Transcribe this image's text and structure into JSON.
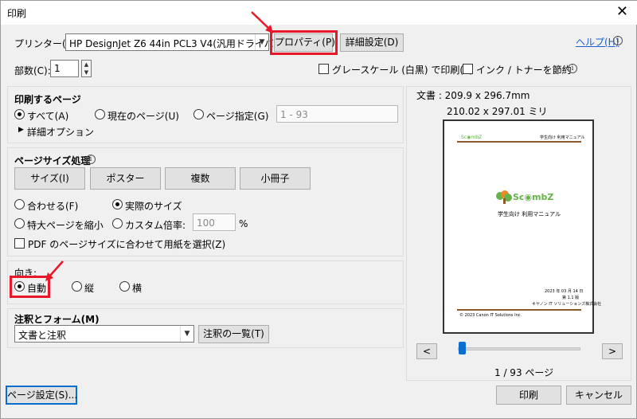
{
  "window": {
    "title": "印刷",
    "close_glyph": "✕"
  },
  "top": {
    "printer_label": "プリンター(N):",
    "printer_value": "HP DesignJet Z6 44in PCL3 V4(汎用ドライバ)",
    "properties_button": "プロパティ(P)",
    "advanced_button": "詳細設定(D)",
    "help_link": "ヘルプ(H)",
    "copies_label": "部数(C):",
    "copies_value": "1",
    "grayscale_label": "グレースケール (白黒) で印刷(Y)",
    "ink_save_label": "インク / トナーを節約"
  },
  "pages_to_print": {
    "title": "印刷するページ",
    "all": "すべて(A)",
    "current": "現在のページ(U)",
    "range": "ページ指定(G)",
    "range_value": "1 - 93",
    "more_options": "詳細オプション"
  },
  "page_sizing": {
    "title": "ページサイズ処理",
    "buttons": [
      "サイズ(I)",
      "ポスター",
      "複数",
      "小冊子"
    ],
    "fit": "合わせる(F)",
    "actual_size": "実際のサイズ",
    "shrink_oversized": "特大ページを縮小",
    "custom_scale": "カスタム倍率:",
    "custom_scale_value": "100",
    "percent": "%",
    "choose_paper_by_pdf": "PDF のページサイズに合わせて用紙を選択(Z)"
  },
  "orientation": {
    "title": "向き:",
    "auto": "自動",
    "portrait": "縦",
    "landscape": "横"
  },
  "comments": {
    "title": "注釈とフォーム(M)",
    "value": "文書と注釈",
    "summarize_button": "注釈の一覧(T)"
  },
  "preview": {
    "doc_size": "文書 : 209.9 x 296.7mm",
    "paper_size": "210.02 x 297.01 ミリ",
    "header_logo": "Sc◉mbZ",
    "header_right": "学生向け 利用マニュアル",
    "logo_text": "Sc◉mbZ",
    "subtitle": "学生向け 利用マニュアル",
    "date": "2023 年 03 月 14 日",
    "edition": "第 1.1 版",
    "company": "キヤノン IT ソリューションズ株式会社",
    "footer": "© 2023 Canon IT Solutions Inc.",
    "prev": "<",
    "next": ">",
    "page_counter": "1 / 93 ページ"
  },
  "bottom": {
    "page_setup": "ページ設定(S)...",
    "print": "印刷",
    "cancel": "キャンセル"
  },
  "colors": {
    "annotation_red": "#e8182a",
    "link_blue": "#1a5fcc",
    "slider_blue": "#0a6ed1",
    "logo_green": "#66b34a",
    "logo_orange": "#e88a2a"
  }
}
